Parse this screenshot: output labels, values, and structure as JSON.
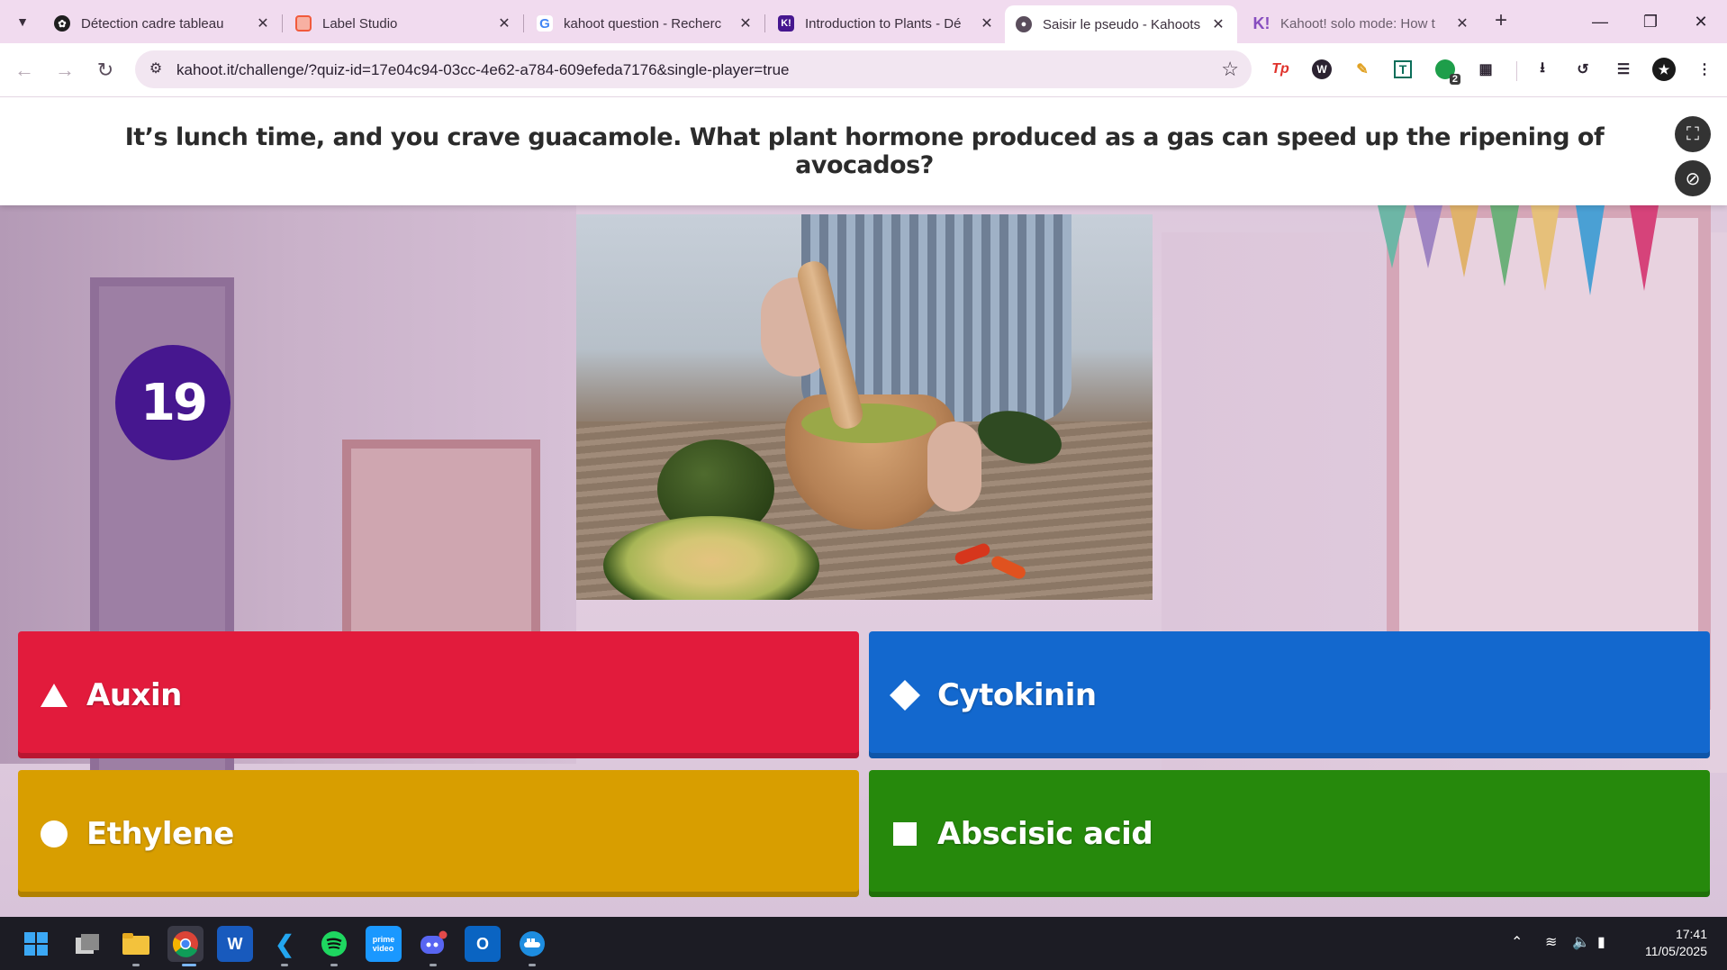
{
  "browser": {
    "tabs": [
      {
        "title": "Détection cadre tableau",
        "favicon": "openai-icon",
        "color": "#1f1f1f",
        "active": false
      },
      {
        "title": "Label Studio",
        "favicon": "label-studio-icon",
        "color": "#f15a3c",
        "active": false
      },
      {
        "title": "kahoot question - Recherc",
        "favicon": "google-icon",
        "color": "#4285f4",
        "active": false
      },
      {
        "title": "Introduction to Plants - Dé",
        "favicon": "kahoot-icon",
        "color": "#46178f",
        "active": false
      },
      {
        "title": "Saisir le pseudo - Kahoots",
        "favicon": "globe-icon",
        "color": "#5a4d5c",
        "active": true
      },
      {
        "title": "Kahoot! solo mode: How t",
        "favicon": "kahoot-k-icon",
        "color": "#864cbf",
        "active": false
      }
    ],
    "url": "kahoot.it/challenge/?quiz-id=17e04c94-03cc-4e62-a784-609efeda7176&single-player=true",
    "extension_badge": "2"
  },
  "quiz": {
    "question": "It’s lunch time, and you crave guacamole. What plant hormone produced as a gas can speed up the ripening of avocados?",
    "timer": "19",
    "answers": [
      {
        "label": "Auxin",
        "shape": "triangle",
        "color": "#e21b3c"
      },
      {
        "label": "Cytokinin",
        "shape": "diamond",
        "color": "#1368ce"
      },
      {
        "label": "Ethylene",
        "shape": "circle",
        "color": "#d89e00"
      },
      {
        "label": "Abscisic acid",
        "shape": "square",
        "color": "#26890c"
      }
    ]
  },
  "taskbar": {
    "apps": [
      "windows-start-icon",
      "task-view-icon",
      "file-explorer-icon",
      "chrome-icon",
      "word-icon",
      "vscode-icon",
      "spotify-icon",
      "prime-video-icon",
      "discord-icon",
      "outlook-icon",
      "docker-icon"
    ],
    "time": "17:41",
    "date": "11/05/2025"
  },
  "colors": {
    "kahoot_purple": "#46178f",
    "tab_strip": "#f1dbef"
  }
}
